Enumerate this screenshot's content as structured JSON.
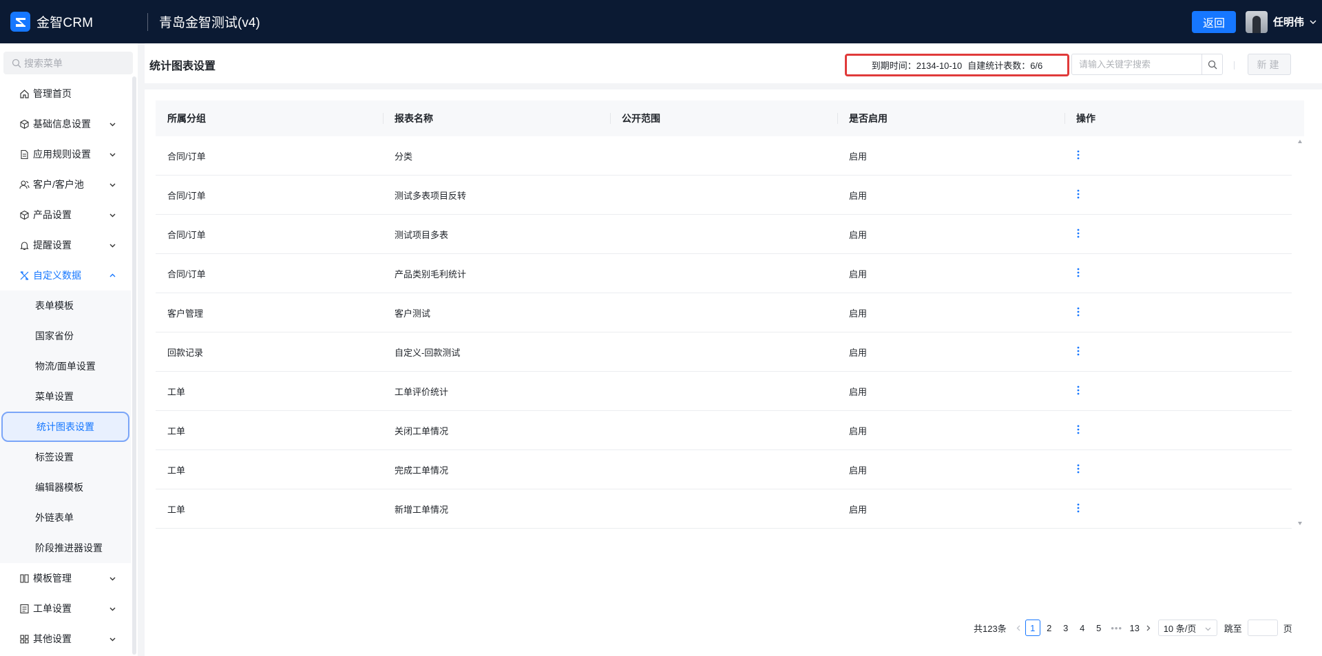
{
  "topbar": {
    "logo_text": "金智CRM",
    "org_name": "青岛金智测试(v4)",
    "back_label": "返回",
    "user_name": "任明伟"
  },
  "sidebar": {
    "search_placeholder": "搜索菜单",
    "items": [
      {
        "label": "管理首页",
        "icon": "home-icon"
      },
      {
        "label": "基础信息设置",
        "icon": "cube-icon"
      },
      {
        "label": "应用规则设置",
        "icon": "file-icon"
      },
      {
        "label": "客户/客户池",
        "icon": "users-icon"
      },
      {
        "label": "产品设置",
        "icon": "box-icon"
      },
      {
        "label": "提醒设置",
        "icon": "bell-icon"
      },
      {
        "label": "自定义数据",
        "icon": "tools-icon"
      },
      {
        "label": "模板管理",
        "icon": "template-icon"
      },
      {
        "label": "工单设置",
        "icon": "ticket-icon"
      },
      {
        "label": "其他设置",
        "icon": "grid-icon"
      }
    ],
    "custom_data_sub": [
      "表单模板",
      "国家省份",
      "物流/面单设置",
      "菜单设置",
      "统计图表设置",
      "标签设置",
      "编辑器模板",
      "外链表单",
      "阶段推进器设置"
    ]
  },
  "header": {
    "title": "统计图表设置",
    "expiry_label": "到期时间：2134-10-10",
    "quota_label": "自建统计表数：6/6",
    "search_placeholder": "请输入关键字搜索",
    "new_label": "新建"
  },
  "table": {
    "columns": [
      "所属分组",
      "报表名称",
      "公开范围",
      "是否启用",
      "操作"
    ],
    "rows": [
      {
        "group": "合同/订单",
        "name": "分类",
        "scope": "",
        "enabled": "启用"
      },
      {
        "group": "合同/订单",
        "name": "测试多表项目反转",
        "scope": "",
        "enabled": "启用"
      },
      {
        "group": "合同/订单",
        "name": "测试项目多表",
        "scope": "",
        "enabled": "启用"
      },
      {
        "group": "合同/订单",
        "name": "产品类别毛利统计",
        "scope": "",
        "enabled": "启用"
      },
      {
        "group": "客户管理",
        "name": "客户测试",
        "scope": "",
        "enabled": "启用"
      },
      {
        "group": "回款记录",
        "name": "自定义-回款测试",
        "scope": "",
        "enabled": "启用"
      },
      {
        "group": "工单",
        "name": "工单评价统计",
        "scope": "",
        "enabled": "启用"
      },
      {
        "group": "工单",
        "name": "关闭工单情况",
        "scope": "",
        "enabled": "启用"
      },
      {
        "group": "工单",
        "name": "完成工单情况",
        "scope": "",
        "enabled": "启用"
      },
      {
        "group": "工单",
        "name": "新增工单情况",
        "scope": "",
        "enabled": "启用"
      }
    ]
  },
  "pagination": {
    "total_label": "共123条",
    "pages": [
      "1",
      "2",
      "3",
      "4",
      "5"
    ],
    "current": "1",
    "ellipsis": "•••",
    "last_page": "13",
    "page_size_label": "10 条/页",
    "goto_label": "跳至",
    "page_suffix": "页"
  },
  "colors": {
    "primary": "#1677ff",
    "topbar_bg": "#0b1a33",
    "highlight_border": "#e03a3a"
  }
}
